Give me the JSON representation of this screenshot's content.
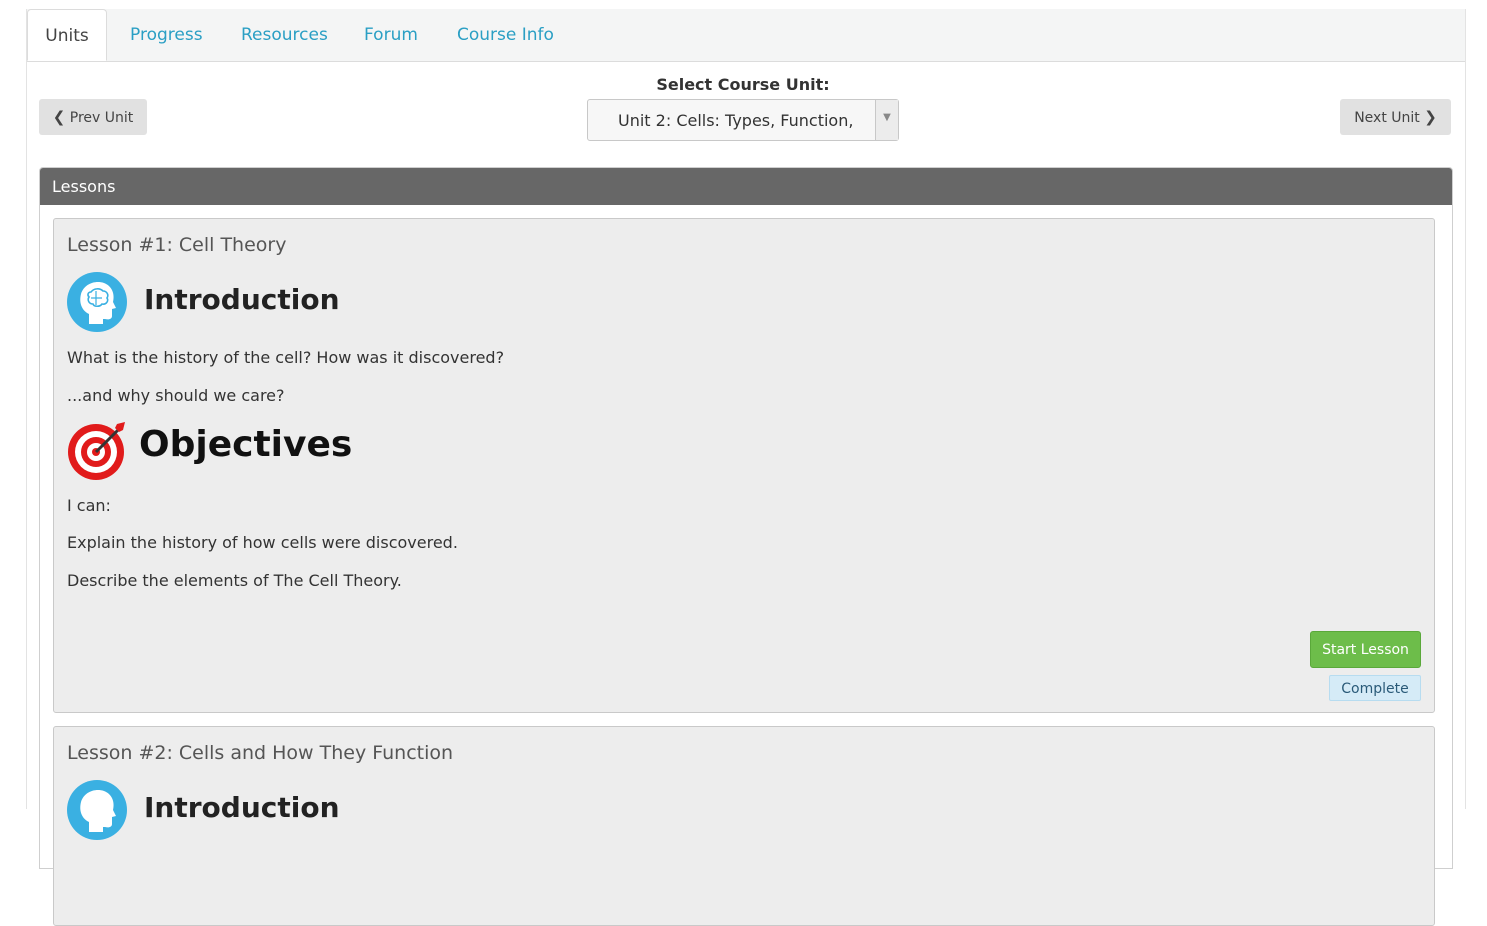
{
  "tabs": [
    {
      "label": "Units",
      "active": true
    },
    {
      "label": "Progress"
    },
    {
      "label": "Resources"
    },
    {
      "label": "Forum"
    },
    {
      "label": "Course Info"
    }
  ],
  "unit_selector": {
    "label": "Select Course Unit:",
    "selected": "Unit 2: Cells: Types, Function,",
    "prev_label": "Prev Unit",
    "next_label": "Next Unit"
  },
  "panel": {
    "title": "Lessons"
  },
  "lessons": [
    {
      "title": "Lesson #1: Cell Theory",
      "intro_heading": "Introduction",
      "intro_lines": [
        "What is the history of the cell? How was it discovered?",
        "...and why should we care?"
      ],
      "objectives_heading": "Objectives",
      "objectives_lines": [
        "I can:",
        "Explain the history of how cells were discovered.",
        "Describe the elements of The Cell Theory."
      ],
      "start_label": "Start Lesson",
      "status": "Complete"
    },
    {
      "title": "Lesson #2: Cells and How They Function",
      "intro_heading": "Introduction"
    }
  ],
  "colors": {
    "accent_link": "#2a9fc4",
    "panel_header": "#676767",
    "start_button": "#6dbd4a",
    "complete_badge": "#d5ebf7",
    "intro_icon": "#3ab0e2",
    "target_icon": "#e11b1b"
  },
  "icons": {
    "intro": "head-brain-icon",
    "objectives": "target-icon",
    "prev": "chevron-left-icon",
    "next": "chevron-right-icon",
    "dropdown": "caret-down-icon"
  }
}
